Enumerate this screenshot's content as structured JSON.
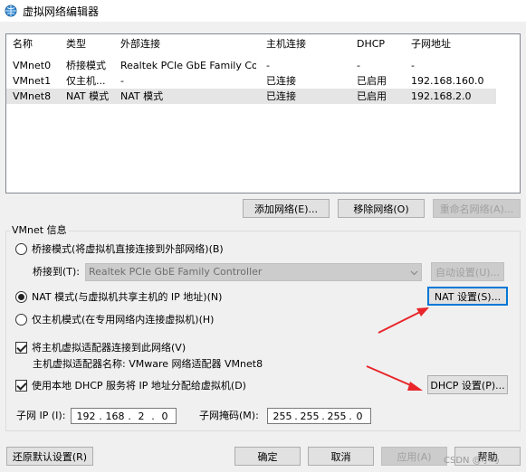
{
  "window": {
    "title": "虚拟网络编辑器"
  },
  "network_table": {
    "headers": [
      "名称",
      "类型",
      "外部连接",
      "主机连接",
      "DHCP",
      "子网地址"
    ],
    "rows": [
      [
        "VMnet0",
        "桥接模式",
        "Realtek PCIe GbE Family Co...",
        "-",
        "-",
        "-"
      ],
      [
        "VMnet1",
        "仅主机...",
        "-",
        "已连接",
        "已启用",
        "192.168.160.0"
      ],
      [
        "VMnet8",
        "NAT 模式",
        "NAT 模式",
        "已连接",
        "已启用",
        "192.168.2.0"
      ]
    ],
    "selected_row": 2
  },
  "list_buttons": {
    "add": "添加网络(E)...",
    "remove": "移除网络(O)",
    "rename": "重命名网络(A)..."
  },
  "vmnet_info": {
    "label": "VMnet 信息",
    "bridge_radio": "桥接模式(将虚拟机直接连接到外部网络)(B)",
    "bridge_to_label": "桥接到(T):",
    "bridge_to_value": "Realtek PCIe GbE Family Controller",
    "auto_settings": "自动设置(U)...",
    "nat_radio": "NAT 模式(与虚拟机共享主机的 IP 地址)(N)",
    "nat_settings": "NAT 设置(S)...",
    "host_only_radio": "仅主机模式(在专用网络内连接虚拟机)(H)",
    "selected_mode": "nat",
    "connect_adapter_check": "将主机虚拟适配器连接到此网络(V)",
    "adapter_name_label": "主机虚拟适配器名称: VMware 网络适配器 VMnet8",
    "dhcp_check": "使用本地 DHCP 服务将 IP 地址分配给虚拟机(D)",
    "dhcp_settings": "DHCP 设置(P)...",
    "subnet_ip_label": "子网 IP (I):",
    "subnet_ip": [
      "192",
      "168",
      "2",
      "0"
    ],
    "subnet_mask_label": "子网掩码(M):",
    "subnet_mask": [
      "255",
      "255",
      "255",
      "0"
    ],
    "connect_adapter_checked": true,
    "dhcp_checked": true
  },
  "footer": {
    "restore": "还原默认设置(R)",
    "ok": "确定",
    "cancel": "取消",
    "apply": "应用(A)",
    "help": "帮助"
  },
  "watermark": "CSDN @小马",
  "colors": {
    "annotation_arrow": "#e8262b",
    "accent": "#0078d7"
  }
}
